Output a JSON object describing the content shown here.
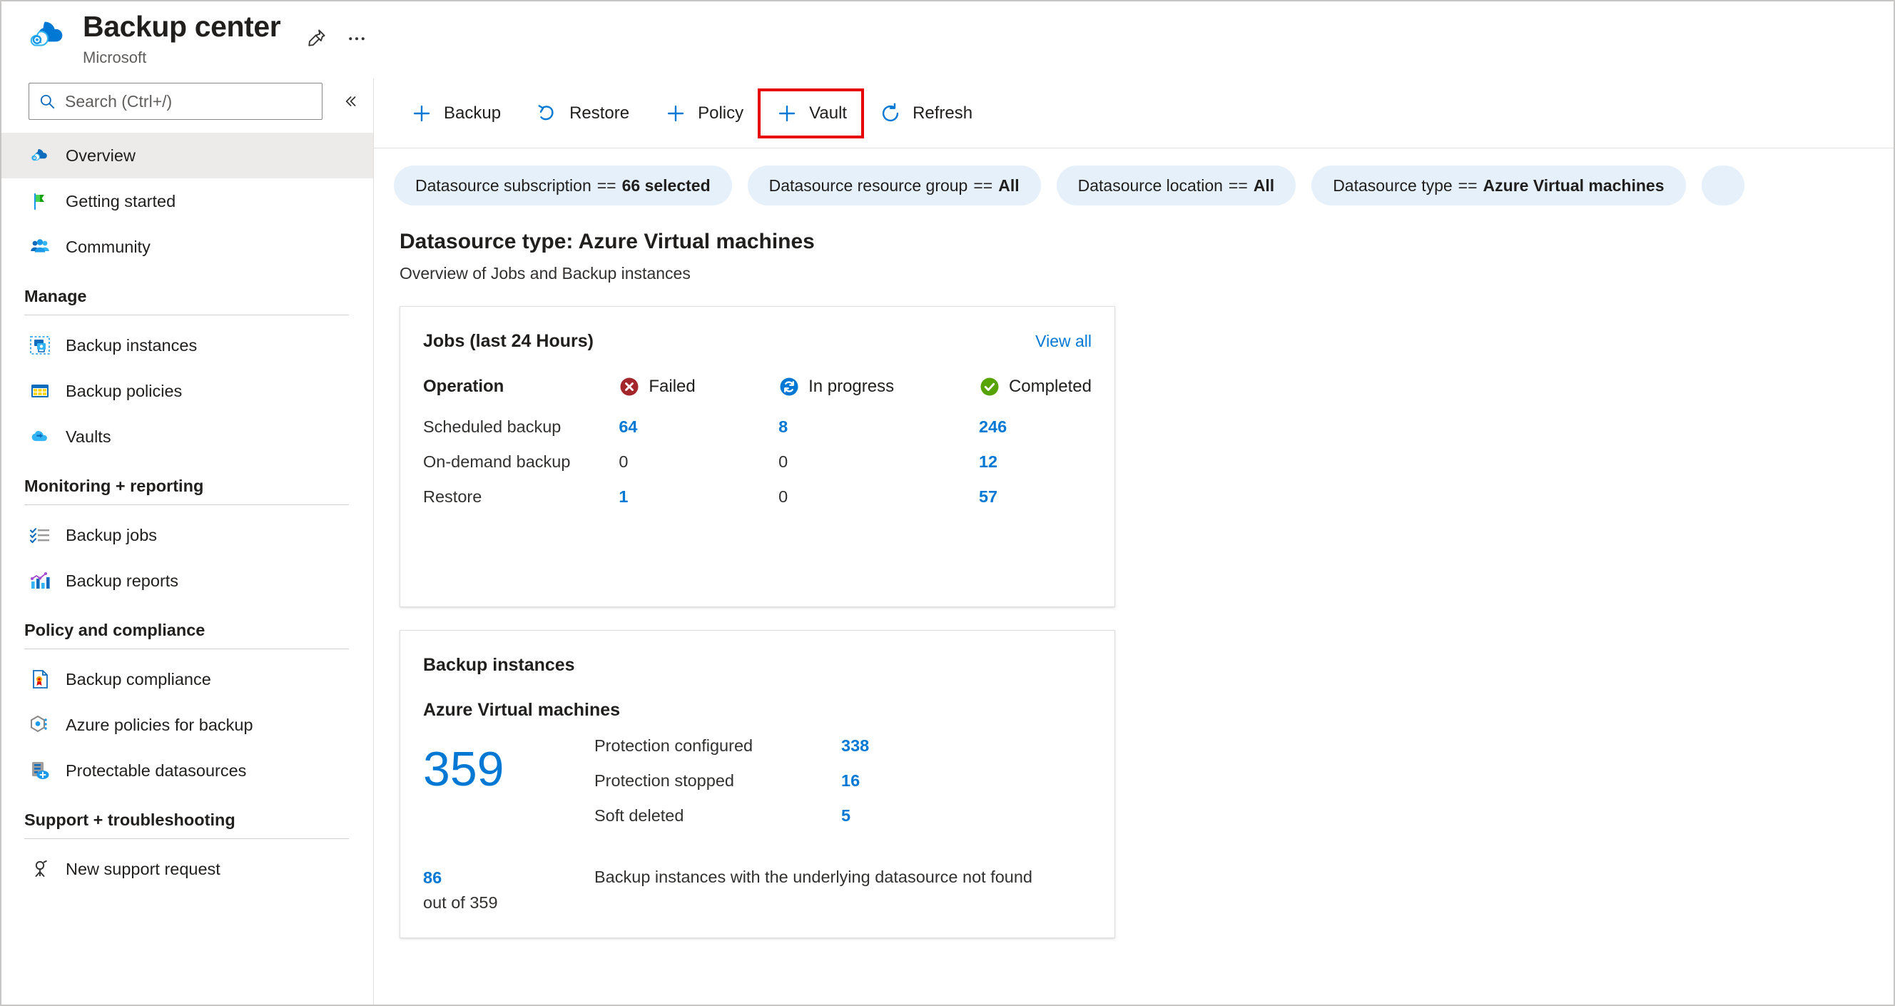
{
  "header": {
    "title": "Backup center",
    "subtitle": "Microsoft",
    "pin_icon": "pin-icon",
    "more_icon": "ellipsis-icon"
  },
  "search": {
    "placeholder": "Search (Ctrl+/)",
    "value": "",
    "icon": "search-icon",
    "collapse_icon": "chevron-double-left-icon"
  },
  "sidebar": {
    "top_items": [
      {
        "label": "Overview",
        "icon": "backup-cloud-icon",
        "selected": true
      },
      {
        "label": "Getting started",
        "icon": "flag-icon",
        "selected": false
      },
      {
        "label": "Community",
        "icon": "people-icon",
        "selected": false
      }
    ],
    "groups": [
      {
        "title": "Manage",
        "items": [
          {
            "label": "Backup instances",
            "icon": "backup-instances-icon"
          },
          {
            "label": "Backup policies",
            "icon": "backup-policies-icon"
          },
          {
            "label": "Vaults",
            "icon": "vault-cloud-icon"
          }
        ]
      },
      {
        "title": "Monitoring + reporting",
        "items": [
          {
            "label": "Backup jobs",
            "icon": "checklist-icon"
          },
          {
            "label": "Backup reports",
            "icon": "bar-chart-icon"
          }
        ]
      },
      {
        "title": "Policy and compliance",
        "items": [
          {
            "label": "Backup compliance",
            "icon": "compliance-document-icon"
          },
          {
            "label": "Azure policies for backup",
            "icon": "azure-policy-icon"
          },
          {
            "label": "Protectable datasources",
            "icon": "protectable-datasource-icon"
          }
        ]
      },
      {
        "title": "Support + troubleshooting",
        "items": [
          {
            "label": "New support request",
            "icon": "support-person-icon"
          }
        ]
      }
    ]
  },
  "toolbar": {
    "buttons": [
      {
        "label": "Backup",
        "icon": "plus-icon",
        "highlighted": false
      },
      {
        "label": "Restore",
        "icon": "undo-icon",
        "highlighted": false
      },
      {
        "label": "Policy",
        "icon": "plus-icon",
        "highlighted": false
      },
      {
        "label": "Vault",
        "icon": "plus-icon",
        "highlighted": true
      },
      {
        "label": "Refresh",
        "icon": "refresh-icon",
        "highlighted": false
      }
    ],
    "highlight_color": "#e60000"
  },
  "filters": [
    {
      "name": "Datasource subscription",
      "operator": "==",
      "value": "66 selected"
    },
    {
      "name": "Datasource resource group",
      "operator": "==",
      "value": "All"
    },
    {
      "name": "Datasource location",
      "operator": "==",
      "value": "All"
    },
    {
      "name": "Datasource type",
      "operator": "==",
      "value": "Azure Virtual machines"
    }
  ],
  "content": {
    "page_title": "Datasource type: Azure Virtual machines",
    "page_subtitle": "Overview of Jobs and Backup instances",
    "jobs_card": {
      "title": "Jobs (last 24 Hours)",
      "view_all": "View all",
      "columns": [
        {
          "label": "Operation",
          "icon": null
        },
        {
          "label": "Failed",
          "icon": "error-circle-icon"
        },
        {
          "label": "In progress",
          "icon": "sync-circle-icon"
        },
        {
          "label": "Completed",
          "icon": "success-circle-icon"
        }
      ],
      "rows": [
        {
          "operation": "Scheduled backup",
          "failed": "64",
          "in_progress": "8",
          "completed": "246"
        },
        {
          "operation": "On-demand backup",
          "failed": "0",
          "in_progress": "0",
          "completed": "12"
        },
        {
          "operation": "Restore",
          "failed": "1",
          "in_progress": "0",
          "completed": "57"
        }
      ]
    },
    "instances_card": {
      "title": "Backup instances",
      "subtitle": "Azure Virtual machines",
      "total": "359",
      "stats": [
        {
          "label": "Protection configured",
          "value": "338"
        },
        {
          "label": "Protection stopped",
          "value": "16"
        },
        {
          "label": "Soft deleted",
          "value": "5"
        }
      ],
      "footer_value": "86",
      "footer_outof": "out of 359",
      "footer_text": "Backup instances with the underlying datasource not found"
    }
  },
  "colors": {
    "accent": "#0078d4",
    "failed": "#a4262c",
    "in_progress": "#0078d4",
    "completed": "#57a300",
    "pill_bg": "#e5f0fa",
    "selected_bg": "#edebe9"
  }
}
